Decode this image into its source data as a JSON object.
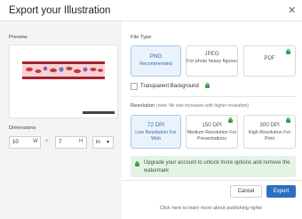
{
  "dialog": {
    "title": "Export your Illustration"
  },
  "preview": {
    "label": "Preview"
  },
  "dimensions": {
    "label": "Dimensions",
    "width": "10",
    "width_tag": "W",
    "times": "×",
    "height": "7",
    "height_tag": "H",
    "unit": "in"
  },
  "file_type": {
    "label": "File Type",
    "options": [
      {
        "title": "PNG",
        "sub": "Recommended",
        "selected": true,
        "locked": false
      },
      {
        "title": "JPEG",
        "sub": "For photo heavy figures",
        "selected": false,
        "locked": false
      },
      {
        "title": "PDF",
        "sub": "",
        "selected": false,
        "locked": true
      }
    ],
    "transparent_label": "Transparent Background"
  },
  "resolution": {
    "label": "Resolution",
    "note": "(note: file size increases with higher resolution)",
    "options": [
      {
        "title": "72 DPI",
        "sub": "Low Resolution For Web",
        "selected": true,
        "locked": false
      },
      {
        "title": "150 DPI",
        "sub": "Medium Resolution For Presentations",
        "selected": false,
        "locked": true
      },
      {
        "title": "300 DPI",
        "sub": "High Resolution For Print",
        "selected": false,
        "locked": true
      }
    ]
  },
  "upgrade": {
    "text": "Upgrade your account to unlock more options and remove the watermark"
  },
  "actions": {
    "cancel": "Cancel",
    "export": "Export"
  },
  "footer": {
    "link": "Click here to learn more about publishing rights"
  },
  "colors": {
    "accent": "#2c6fc0",
    "lock": "#3aa14a",
    "banner_bg": "#e5f3e7"
  }
}
